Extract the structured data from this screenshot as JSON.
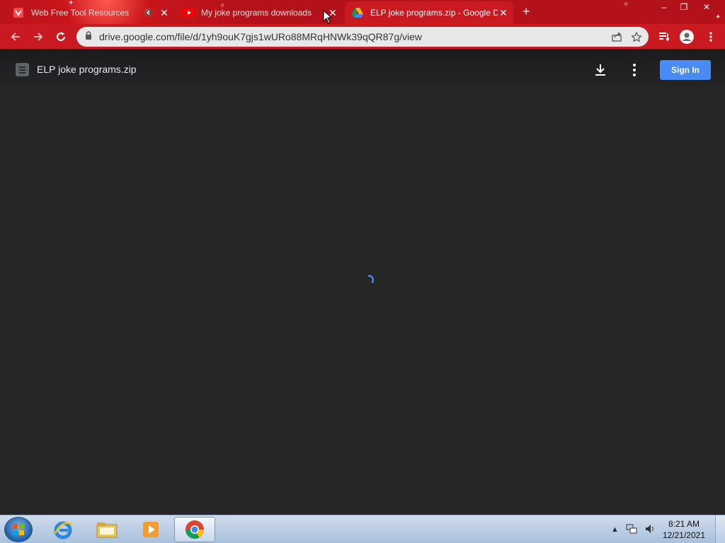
{
  "tabs": [
    {
      "title": "Web Free Tool Resources",
      "favicon": "red-app-icon",
      "muted": false
    },
    {
      "title": "My joke programs downloads",
      "favicon": "youtube-icon",
      "muted": true
    },
    {
      "title": "ELP joke programs.zip - Google Drive",
      "favicon": "google-drive-icon",
      "active": true
    }
  ],
  "new_tab_label": "+",
  "window_controls": {
    "minimize": "–",
    "restore": "❐",
    "close": "✕"
  },
  "toolbar": {
    "url": "drive.google.com/file/d/1yh9ouK7gjs1wURo88MRqHNWk39qQR87g/view"
  },
  "drive": {
    "file_name": "ELP joke programs.zip",
    "sign_in_label": "Sign In"
  },
  "taskbar": {
    "time": "8:21 AM",
    "date": "12/21/2021"
  },
  "colors": {
    "tabstrip": "#b3121a",
    "toolbar": "#c81a20",
    "viewer_bg": "#262626",
    "sign_in": "#4a8af4",
    "spinner": "#4a8af4"
  }
}
